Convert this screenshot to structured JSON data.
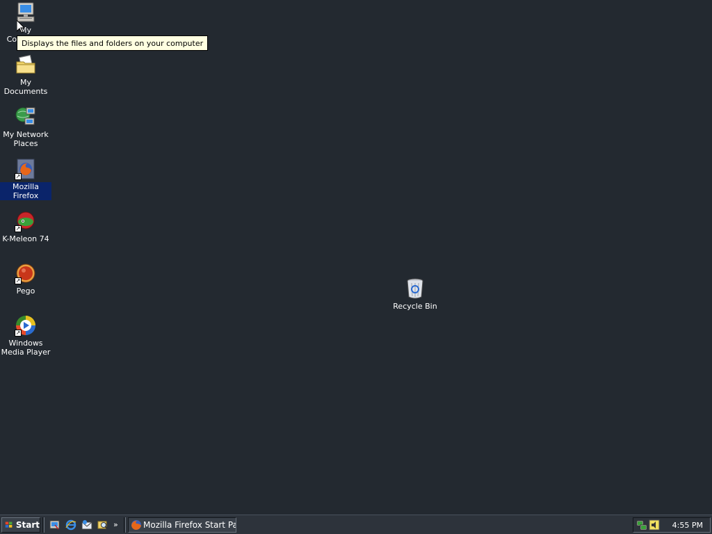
{
  "desktop": {
    "icons": [
      {
        "label": "My Computer",
        "icon": "computer-icon"
      },
      {
        "label": "My Documents",
        "icon": "folder-documents-icon"
      },
      {
        "label": "My Network Places",
        "icon": "network-places-icon"
      },
      {
        "label": "Mozilla Firefox",
        "icon": "firefox-icon",
        "selected": true
      },
      {
        "label": "K-Meleon 74",
        "icon": "kmeleon-icon"
      },
      {
        "label": "Pego",
        "icon": "pego-icon"
      },
      {
        "label": "Windows Media Player",
        "icon": "media-player-icon"
      },
      {
        "label": "Recycle Bin",
        "icon": "recycle-bin-icon"
      }
    ],
    "tooltip": "Displays the files and folders on your computer",
    "background_color": "#232930"
  },
  "taskbar": {
    "start_label": "Start",
    "quick_launch": [
      "show-desktop-icon",
      "internet-explorer-icon",
      "outlook-express-icon",
      "search-icon"
    ],
    "more_label": "»",
    "tasks": [
      {
        "label": "Mozilla Firefox Start Page...",
        "icon": "firefox-icon"
      }
    ],
    "tray_icons": [
      "network-tray-icon",
      "volume-tray-icon"
    ],
    "clock": "4:55 PM"
  }
}
